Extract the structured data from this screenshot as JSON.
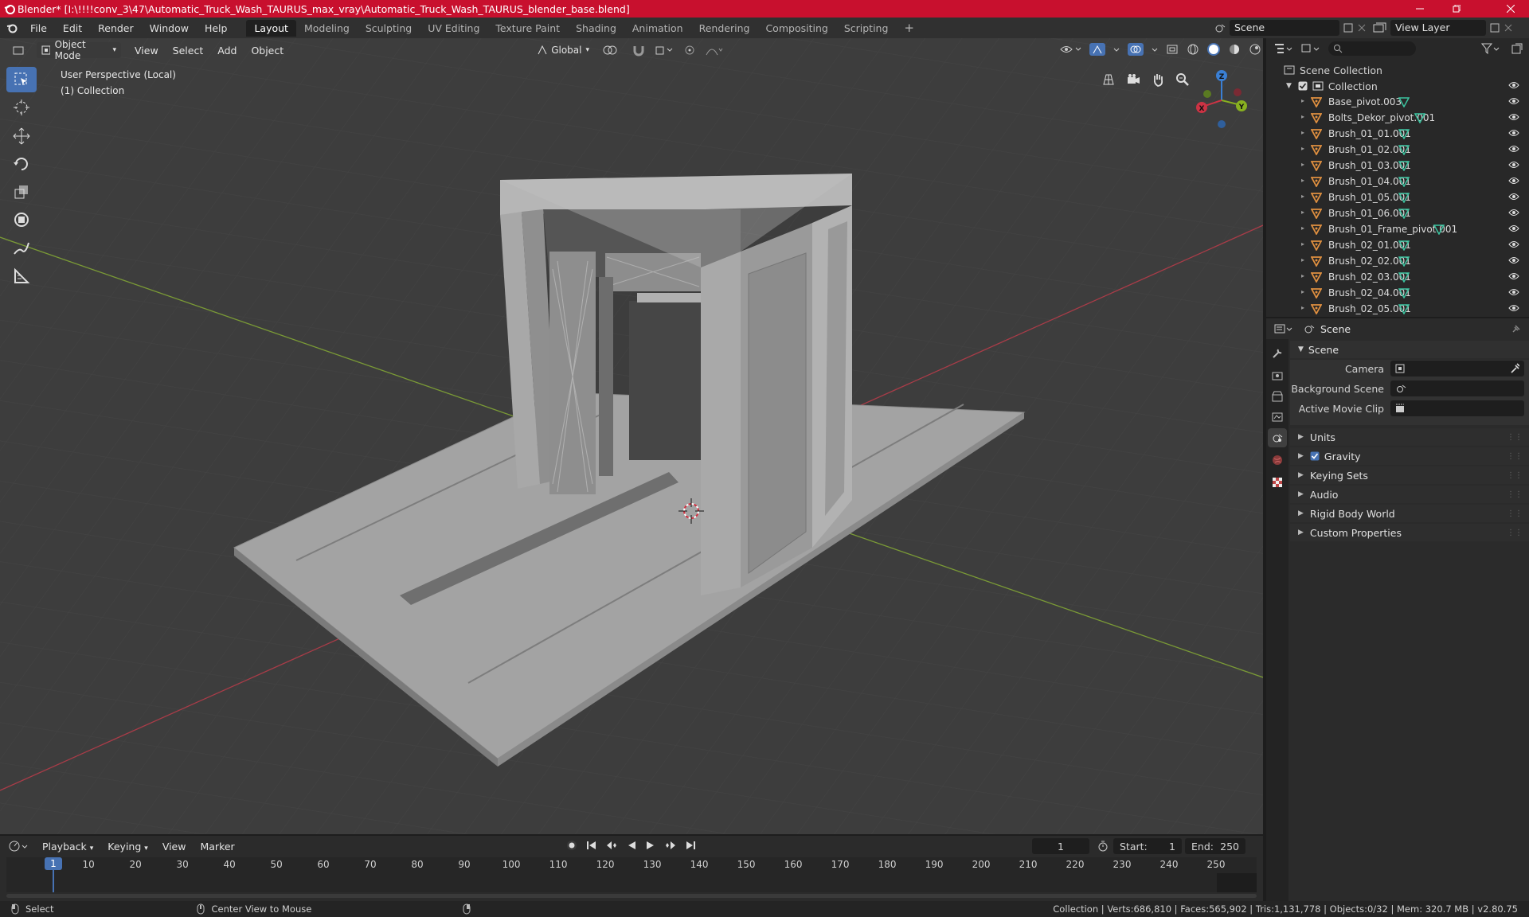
{
  "titlebar": {
    "title": "Blender* [I:\\!!!!conv_3\\47\\Automatic_Truck_Wash_TAURUS_max_vray\\Automatic_Truck_Wash_TAURUS_blender_base.blend]"
  },
  "menubar": {
    "items": [
      "File",
      "Edit",
      "Render",
      "Window",
      "Help"
    ]
  },
  "workspaces": {
    "tabs": [
      "Layout",
      "Modeling",
      "Sculpting",
      "UV Editing",
      "Texture Paint",
      "Shading",
      "Animation",
      "Rendering",
      "Compositing",
      "Scripting"
    ],
    "active": "Layout",
    "add": "+"
  },
  "scene_selector": {
    "label": "Scene"
  },
  "view_layer": {
    "label": "View Layer"
  },
  "viewport_header": {
    "mode": "Object Mode",
    "menus": [
      "View",
      "Select",
      "Add",
      "Object"
    ],
    "transform_orientation": "Global"
  },
  "viewport": {
    "perspective": "User Perspective (Local)",
    "collection": "(1) Collection"
  },
  "gizmo": {
    "x": "X",
    "y": "Y",
    "z": "Z"
  },
  "outliner": {
    "root": "Scene Collection",
    "collection": "Collection",
    "items": [
      "Base_pivot.003",
      "Bolts_Dekor_pivot.001",
      "Brush_01_01.001",
      "Brush_01_02.001",
      "Brush_01_03.001",
      "Brush_01_04.001",
      "Brush_01_05.001",
      "Brush_01_06.001",
      "Brush_01_Frame_pivot.001",
      "Brush_02_01.001",
      "Brush_02_02.001",
      "Brush_02_03.001",
      "Brush_02_04.001",
      "Brush_02_05.001"
    ]
  },
  "properties": {
    "context": "Scene",
    "panel": "Scene",
    "fields": {
      "camera": "Camera",
      "background_scene": "Background Scene",
      "active_movie_clip": "Active Movie Clip"
    },
    "sections": [
      "Units",
      "Gravity",
      "Keying Sets",
      "Audio",
      "Rigid Body World",
      "Custom Properties"
    ],
    "gravity_enabled": true
  },
  "timeline": {
    "menus": [
      "Playback",
      "Keying",
      "View",
      "Marker"
    ],
    "current_frame": "1",
    "start_label": "Start:",
    "start": "1",
    "end_label": "End:",
    "end": "250",
    "ticks": [
      "1",
      "10",
      "20",
      "30",
      "40",
      "50",
      "60",
      "70",
      "80",
      "90",
      "100",
      "110",
      "120",
      "130",
      "140",
      "150",
      "160",
      "170",
      "180",
      "190",
      "200",
      "210",
      "220",
      "230",
      "240",
      "250"
    ]
  },
  "statusbar": {
    "select": "Select",
    "center": "Center View to Mouse",
    "stats": "Collection | Verts:686,810 | Faces:565,902 | Tris:1,131,778 | Objects:0/32 | Mem: 320.7 MB | v2.80.75"
  },
  "colors": {
    "accent": "#4772b3",
    "titlebar": "#c8102e",
    "x_axis": "#cc3344",
    "y_axis": "#88b020",
    "z_axis": "#3a7fd4",
    "mesh_icon": "#e09040",
    "vert_icon": "#3bc4a0"
  }
}
